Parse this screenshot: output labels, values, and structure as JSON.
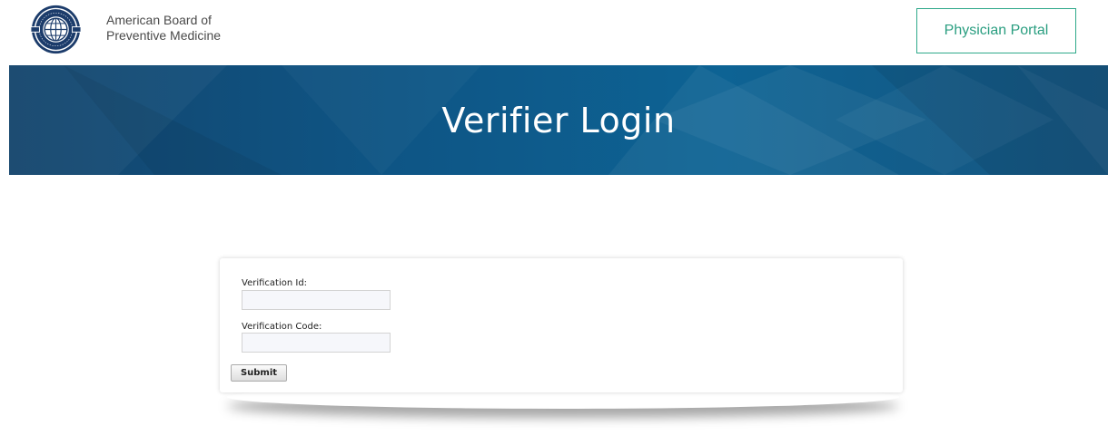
{
  "header": {
    "org_line1": "American Board of",
    "org_line2": "Preventive Medicine",
    "portal_button": "Physician Portal"
  },
  "banner": {
    "title": "Verifier Login"
  },
  "form": {
    "verification_id_label": "Verification Id:",
    "verification_id_value": "",
    "verification_code_label": "Verification Code:",
    "verification_code_value": "",
    "submit_label": "Submit"
  },
  "colors": {
    "accent": "#2fa98a",
    "banner": "#0e5585"
  }
}
